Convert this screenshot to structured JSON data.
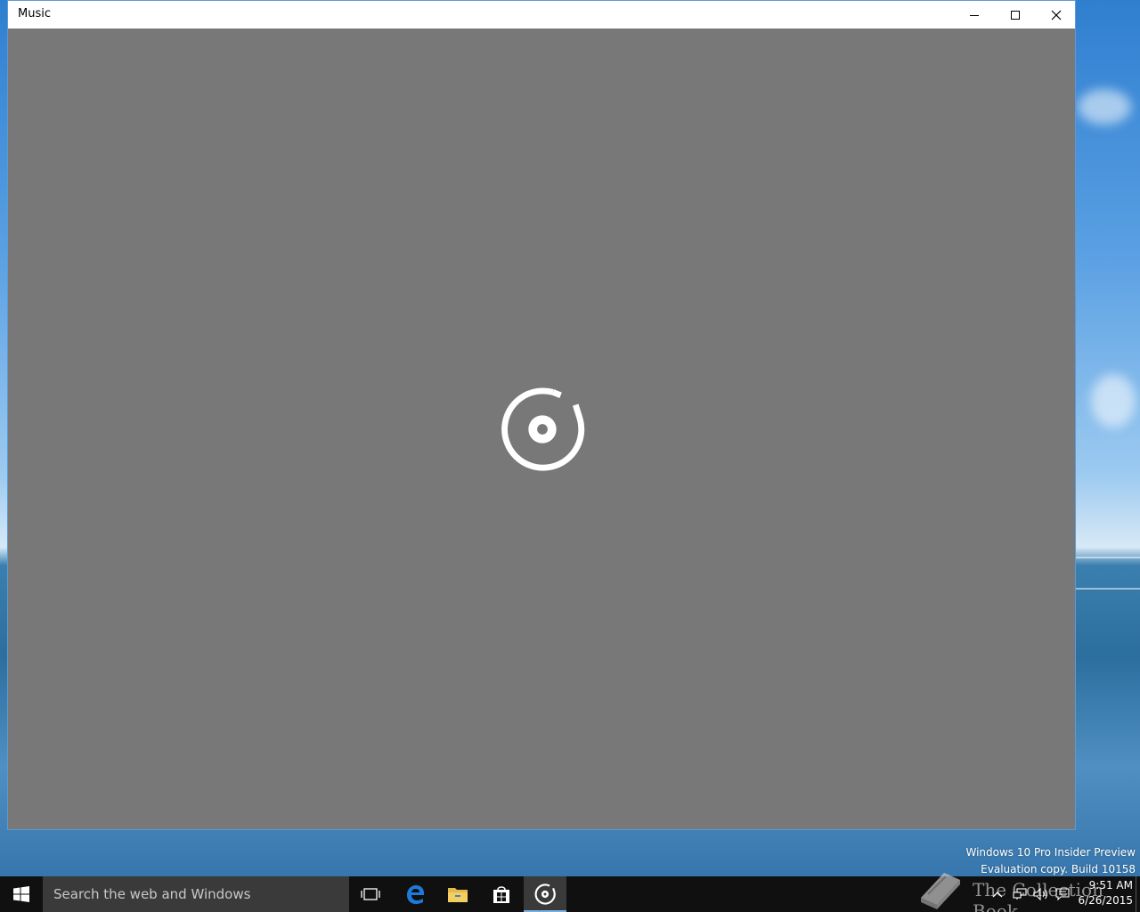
{
  "window": {
    "title": "Music"
  },
  "desktop": {
    "watermark_line1": "Windows 10 Pro Insider Preview",
    "watermark_line2": "Evaluation copy. Build 10158",
    "overlay_watermark": "The Collection Book"
  },
  "taskbar": {
    "search_placeholder": "Search the web and Windows",
    "clock_time": "9:51 AM",
    "clock_date": "6/26/2015",
    "icons": [
      "windows-start-icon",
      "task-view-icon",
      "edge-icon",
      "file-explorer-icon",
      "store-icon",
      "groove-music-icon"
    ]
  },
  "colors": {
    "window_bg": "#787878",
    "taskbar_bg": "#101010",
    "accent": "#5b9bd5"
  }
}
